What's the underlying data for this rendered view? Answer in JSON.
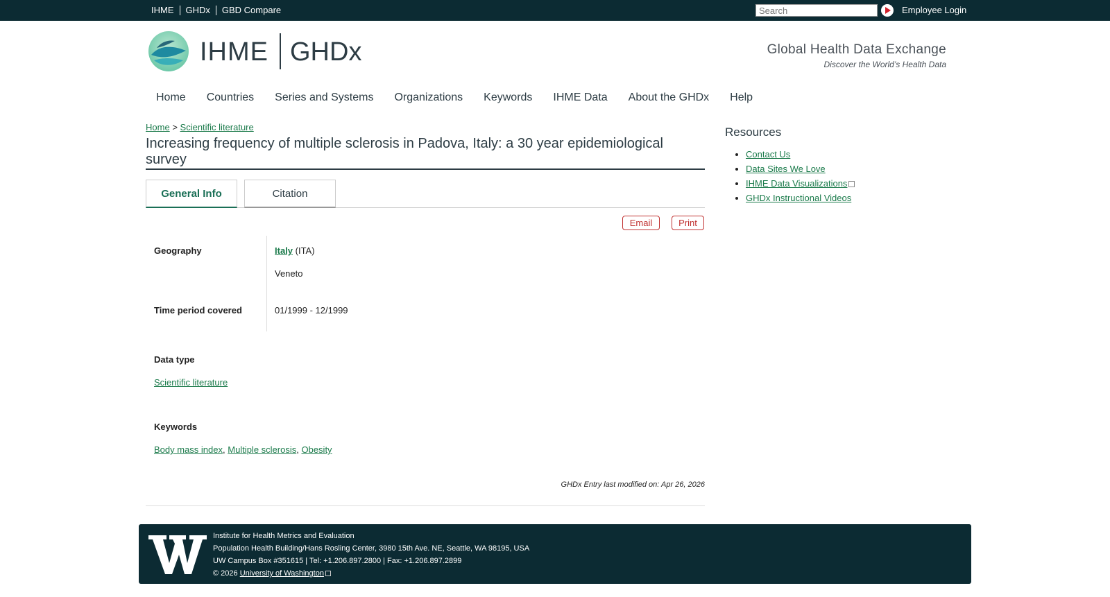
{
  "topbar": {
    "links": [
      "IHME",
      "GHDx",
      "GBD Compare"
    ],
    "search_placeholder": "Search",
    "login_label": "Employee Login"
  },
  "header": {
    "brand_left": "IHME",
    "brand_right": "GHDx",
    "tagline_title": "Global Health Data Exchange",
    "tagline_sub": "Discover the World’s Health Data"
  },
  "nav": {
    "items": [
      "Home",
      "Countries",
      "Series and Systems",
      "Organizations",
      "Keywords",
      "IHME Data",
      "About the GHDx",
      "Help"
    ]
  },
  "breadcrumb": {
    "home": "Home",
    "separator": ">",
    "current": "Scientific literature"
  },
  "page_title": "Increasing frequency of multiple sclerosis in Padova, Italy: a 30 year epidemiological survey",
  "tabs": {
    "general": "General Info",
    "citation": "Citation"
  },
  "actions": {
    "email": "Email",
    "print": "Print"
  },
  "info": {
    "geography_label": "Geography",
    "country_link": "Italy",
    "country_code": "(ITA)",
    "region": "Veneto",
    "time_label": "Time period covered",
    "time_value": "01/1999 - 12/1999",
    "data_type_label": "Data type",
    "data_type_link": "Scientific literature",
    "keywords_label": "Keywords",
    "keywords": [
      "Body mass index",
      "Multiple sclerosis",
      "Obesity"
    ],
    "keyword_sep": ","
  },
  "modified": "GHDx Entry last modified on: Apr 26, 2026",
  "sidebar": {
    "title": "Resources",
    "links": [
      "Contact Us",
      "Data Sites We Love",
      "IHME Data Visualizations",
      "GHDx Instructional Videos"
    ]
  },
  "footer": {
    "line1": "Institute for Health Metrics and Evaluation",
    "line2": "Population Health Building/Hans Rosling Center, 3980 15th Ave. NE, Seattle, WA 98195, USA",
    "line3": "UW Campus Box #351615 | Tel: +1.206.897.2800 | Fax: +1.206.897.2899",
    "copyright": "© 2026",
    "uw_link": "University of Washington"
  },
  "colors": {
    "topbar_bg": "#0c2b33",
    "link_green": "#1a7a4a",
    "accent_red": "#c0302f"
  }
}
